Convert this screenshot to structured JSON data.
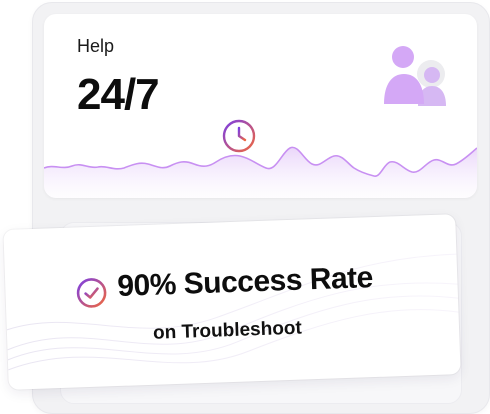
{
  "help_card": {
    "label": "Help",
    "value": "24/7",
    "icons": {
      "users": "users-icon",
      "clock": "clock-icon"
    }
  },
  "success_card": {
    "title": "90% Success Rate",
    "subtitle": "on Troubleshoot",
    "icon": "check-circle-icon"
  },
  "colors": {
    "accent_purple": "#b66bf0",
    "accent_purple_light": "#dcb8f7",
    "gradient_start": "#7b3fe4",
    "gradient_end": "#f0673d",
    "text_dark": "#0d0d0d"
  }
}
